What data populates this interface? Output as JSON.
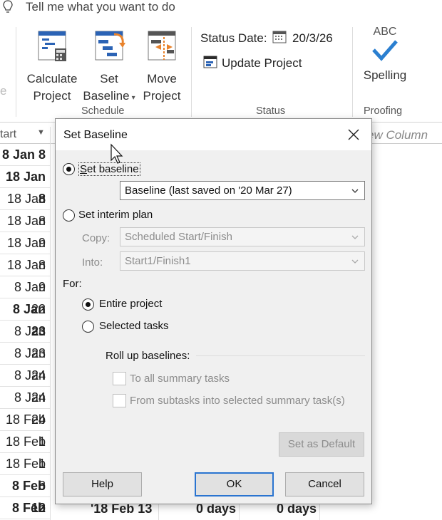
{
  "tell_me": {
    "placeholder_text": "Tell me what you want to do"
  },
  "ribbon": {
    "partial_left_label": "e",
    "calculate_project": {
      "line1": "Calculate",
      "line2": "Project"
    },
    "set_baseline": {
      "line1": "Set",
      "line2": "Baseline"
    },
    "move_project": {
      "line1": "Move",
      "line2": "Project"
    },
    "status_date_label": "Status Date:",
    "status_date_value": "20/3/26",
    "update_project": "Update Project",
    "spelling_badge": "ABC",
    "spelling": "Spelling",
    "groups": {
      "schedule": "Schedule",
      "status": "Status",
      "proofing": "Proofing"
    }
  },
  "table": {
    "start_col_header": "tart",
    "new_column_header": "ew Column",
    "rows": [
      {
        "text": "8 Jan 8",
        "bold": true
      },
      {
        "text": "18 Jan 8",
        "bold": true
      },
      {
        "text": "18 Jan 8",
        "bold": false
      },
      {
        "text": "18 Jan 9",
        "bold": false
      },
      {
        "text": "18 Jan 8",
        "bold": false
      },
      {
        "text": "18 Jan 9",
        "bold": false
      },
      {
        "text": "8 Jan 22",
        "bold": false
      },
      {
        "text": "8 Jan 23",
        "bold": true
      },
      {
        "text": "8 Jan 23",
        "bold": false
      },
      {
        "text": "8 Jan 24",
        "bold": false
      },
      {
        "text": "8 Jan 24",
        "bold": false
      },
      {
        "text": "8 Jan 24",
        "bold": false
      },
      {
        "text": "18 Feb 1",
        "bold": false
      },
      {
        "text": "18 Feb 1",
        "bold": false
      },
      {
        "text": "18 Feb 8",
        "bold": false
      },
      {
        "text": "8 Feb 12",
        "bold": true
      },
      {
        "text": "8 Feb 12",
        "bold": true
      }
    ],
    "last_row_extra": {
      "finish": "'18 Feb 13",
      "duration": "0 days",
      "duration2": "0 days"
    }
  },
  "dialog": {
    "title": "Set Baseline",
    "set_baseline": "Set baseline",
    "baseline_select": "Baseline (last saved on '20 Mar 27)",
    "set_interim_plan": "Set interim plan",
    "copy_label": "Copy:",
    "copy_value": "Scheduled Start/Finish",
    "into_label": "Into:",
    "into_value": "Start1/Finish1",
    "for_label": "For:",
    "entire_project": "Entire project",
    "selected_tasks": "Selected tasks",
    "roll_up_label": "Roll up baselines:",
    "to_all_summary": "To all summary tasks",
    "from_subtasks": "From subtasks into selected summary task(s)",
    "set_as_default": "Set as Default",
    "help": "Help",
    "ok": "OK",
    "cancel": "Cancel"
  }
}
